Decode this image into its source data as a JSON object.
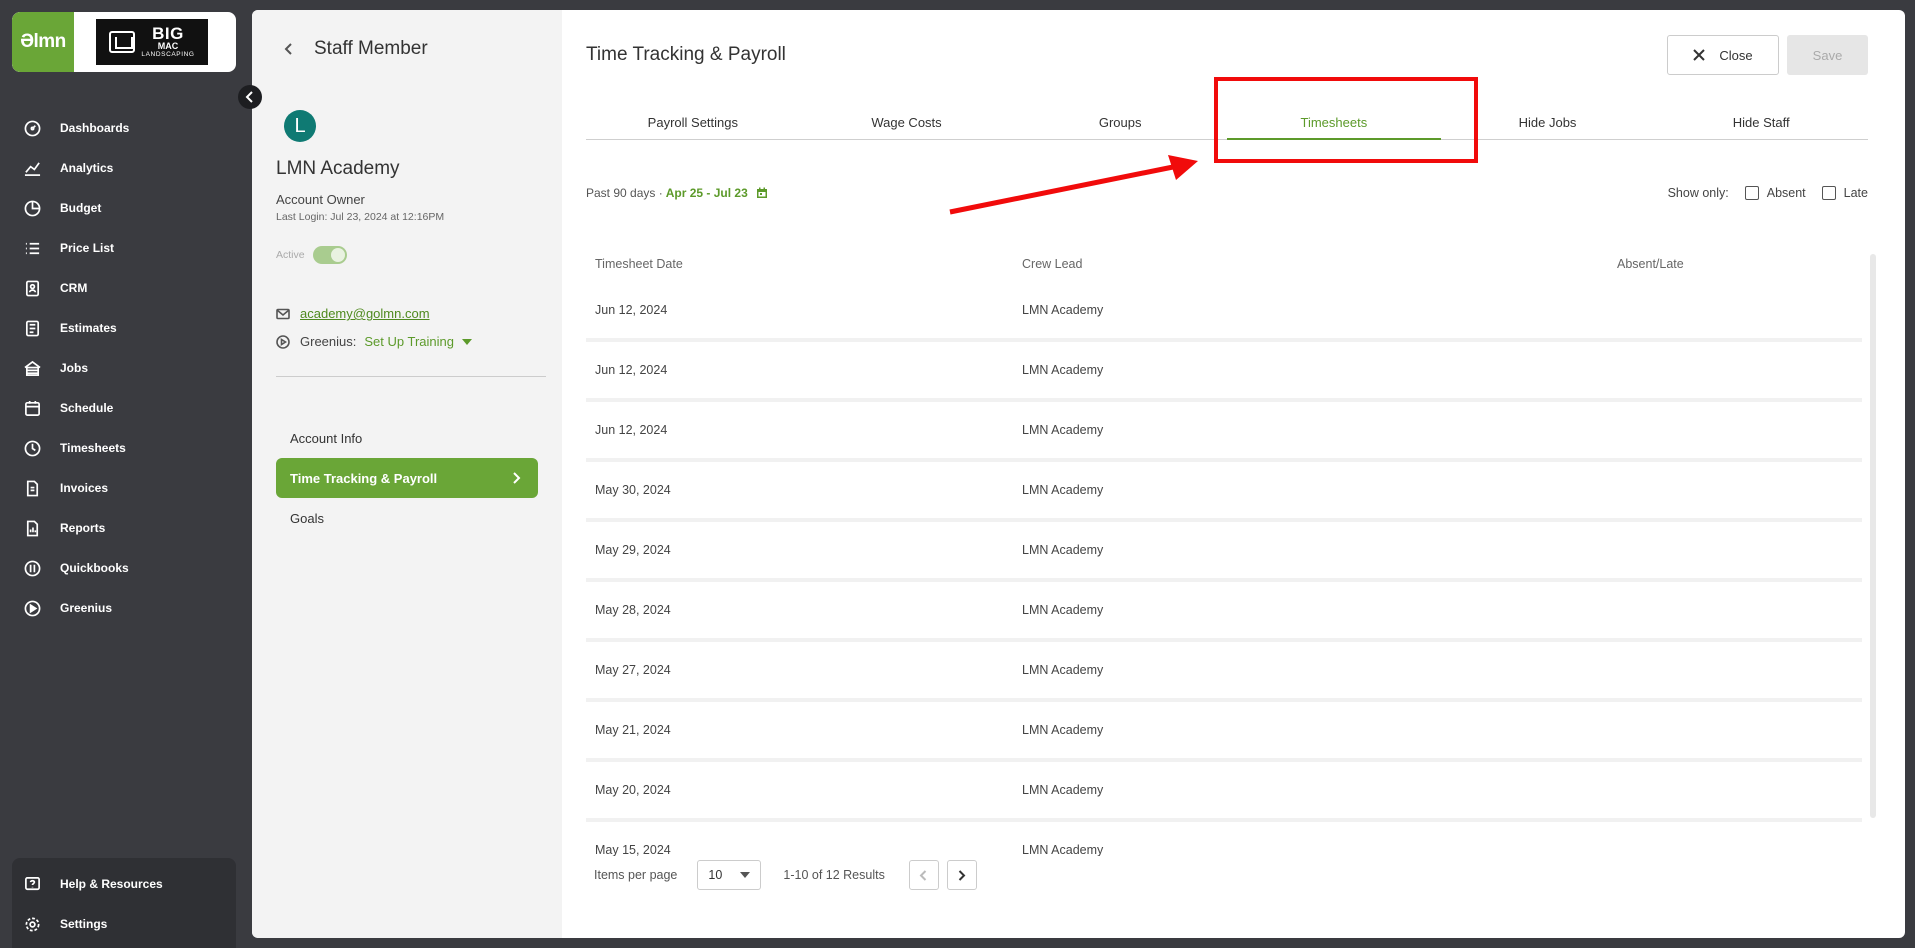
{
  "brand": {
    "app_logo_text": "Əlmn",
    "company_logo": {
      "line1": "BIG",
      "line2": "MAC",
      "line3": "LANDSCAPING"
    }
  },
  "sidebar": {
    "items": [
      {
        "label": "Dashboards",
        "icon": "dashboard-icon"
      },
      {
        "label": "Analytics",
        "icon": "analytics-icon"
      },
      {
        "label": "Budget",
        "icon": "budget-icon"
      },
      {
        "label": "Price List",
        "icon": "list-icon"
      },
      {
        "label": "CRM",
        "icon": "crm-icon"
      },
      {
        "label": "Estimates",
        "icon": "estimates-icon"
      },
      {
        "label": "Jobs",
        "icon": "jobs-icon"
      },
      {
        "label": "Schedule",
        "icon": "calendar-icon"
      },
      {
        "label": "Timesheets",
        "icon": "clock-icon"
      },
      {
        "label": "Invoices",
        "icon": "invoice-icon"
      },
      {
        "label": "Reports",
        "icon": "reports-icon"
      },
      {
        "label": "Quickbooks",
        "icon": "quickbooks-icon"
      },
      {
        "label": "Greenius",
        "icon": "play-icon"
      }
    ],
    "bottom_items": [
      {
        "label": "Help & Resources",
        "icon": "help-icon"
      },
      {
        "label": "Settings",
        "icon": "gear-icon"
      }
    ]
  },
  "staff": {
    "back_title": "Staff Member",
    "avatar_initial": "L",
    "name": "LMN Academy",
    "role": "Account Owner",
    "last_login": "Last Login: Jul 23, 2024 at 12:16PM",
    "active_label": "Active",
    "active": true,
    "email": "academy@golmn.com",
    "greenius_label": "Greenius:",
    "greenius_value": "Set Up Training"
  },
  "menu": {
    "items": [
      {
        "label": "Account Info"
      },
      {
        "label": "Time Tracking & Payroll"
      },
      {
        "label": "Goals"
      }
    ]
  },
  "content": {
    "title": "Time Tracking & Payroll",
    "close_label": "Close",
    "save_label": "Save",
    "tabs": [
      {
        "label": "Payroll Settings"
      },
      {
        "label": "Wage Costs"
      },
      {
        "label": "Groups"
      },
      {
        "label": "Timesheets"
      },
      {
        "label": "Hide Jobs"
      },
      {
        "label": "Hide Staff"
      }
    ],
    "filter": {
      "period": "Past 90 days ·",
      "range": "Apr 25 - Jul 23"
    },
    "show_only": {
      "label": "Show only:",
      "absent": "Absent",
      "late": "Late"
    },
    "table": {
      "headers": [
        "Timesheet Date",
        "Crew Lead",
        "Absent/Late"
      ],
      "rows": [
        {
          "date": "Jun 12, 2024",
          "crew_lead": "LMN Academy"
        },
        {
          "date": "Jun 12, 2024",
          "crew_lead": "LMN Academy"
        },
        {
          "date": "Jun 12, 2024",
          "crew_lead": "LMN Academy"
        },
        {
          "date": "May 30, 2024",
          "crew_lead": "LMN Academy"
        },
        {
          "date": "May 29, 2024",
          "crew_lead": "LMN Academy"
        },
        {
          "date": "May 28, 2024",
          "crew_lead": "LMN Academy"
        },
        {
          "date": "May 27, 2024",
          "crew_lead": "LMN Academy"
        },
        {
          "date": "May 21, 2024",
          "crew_lead": "LMN Academy"
        },
        {
          "date": "May 20, 2024",
          "crew_lead": "LMN Academy"
        },
        {
          "date": "May 15, 2024",
          "crew_lead": "LMN Academy"
        }
      ]
    },
    "pager": {
      "items_per_page_label": "Items per page",
      "per_page": "10",
      "results": "1-10 of 12 Results"
    }
  },
  "colors": {
    "accent": "#6aa637",
    "annotation": "#f10b0b",
    "sidebar_bg": "#3a3b40"
  }
}
